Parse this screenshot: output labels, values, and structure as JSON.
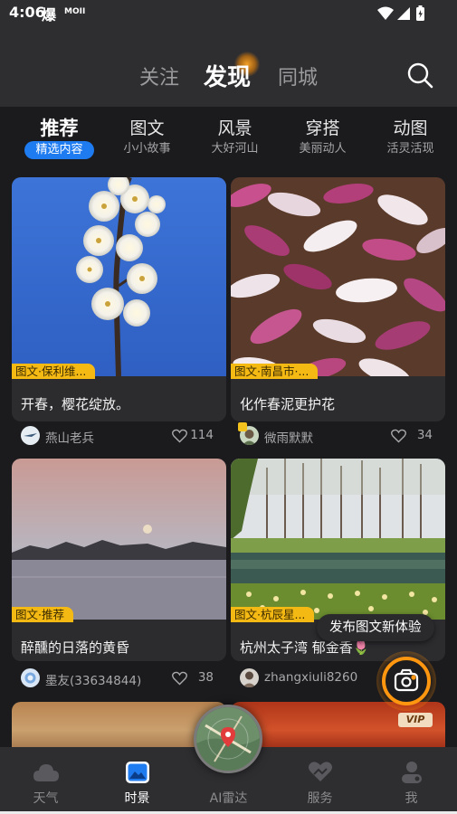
{
  "status": {
    "time": "4:06",
    "app_glyph": "爆",
    "small_text": "MOII"
  },
  "header": {
    "tabs": [
      {
        "label": "关注",
        "active": false
      },
      {
        "label": "发现",
        "active": true
      },
      {
        "label": "同城",
        "active": false
      }
    ],
    "search_icon": "search-icon"
  },
  "categories": [
    {
      "title": "推荐",
      "subtitle": "精选内容",
      "active": true
    },
    {
      "title": "图文",
      "subtitle": "小小故事",
      "active": false
    },
    {
      "title": "风景",
      "subtitle": "大好河山",
      "active": false
    },
    {
      "title": "穿搭",
      "subtitle": "美丽动人",
      "active": false
    },
    {
      "title": "动图",
      "subtitle": "活灵活现",
      "active": false
    }
  ],
  "feed": [
    {
      "tag": "图文·保利维...",
      "title": "开春，樱花绽放。",
      "author": "燕山老兵",
      "likes": "114"
    },
    {
      "tag": "图文·南昌市·...",
      "title": "化作春泥更护花",
      "author": "微雨默默",
      "likes": "34"
    },
    {
      "tag": "图文·推荐",
      "title": "醉醺的日落的黄昏",
      "author": "墨友(33634844)",
      "likes": "38"
    },
    {
      "tag": "图文·杭辰星...",
      "title": "杭州太子湾  郁金香🌷",
      "author": "zhangxiuli8260",
      "likes": ""
    }
  ],
  "fab": {
    "tooltip": "发布图文新体验",
    "icon": "camera-icon"
  },
  "vip_badge": "VIP",
  "bottom_nav": [
    {
      "label": "天气",
      "icon": "cloud-icon",
      "active": false
    },
    {
      "label": "时景",
      "icon": "photo-icon",
      "active": true
    },
    {
      "label": "AI雷达",
      "icon": "radar-map-icon",
      "active": false
    },
    {
      "label": "服务",
      "icon": "heart-hands-icon",
      "active": false
    },
    {
      "label": "我",
      "icon": "person-icon",
      "active": false
    }
  ],
  "colors": {
    "accent": "#1e7bf0",
    "tag": "#f5b914",
    "fab_ring": "#ff9610"
  }
}
